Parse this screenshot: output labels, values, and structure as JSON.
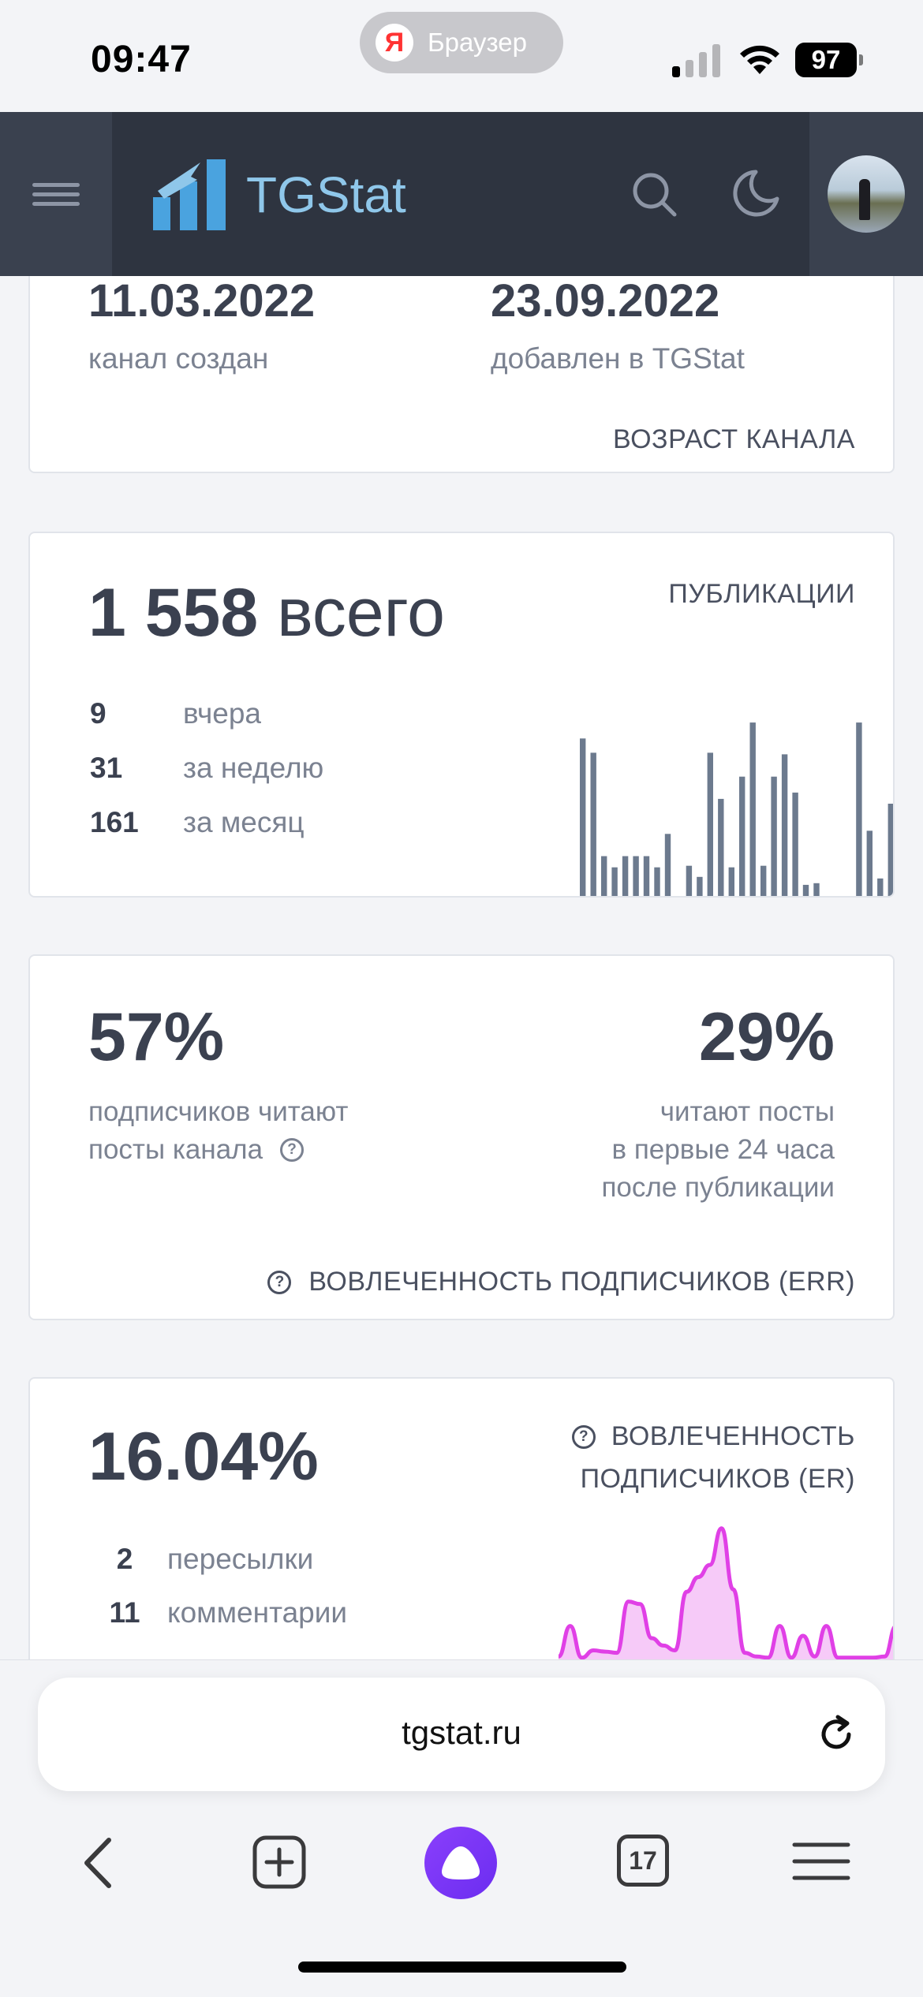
{
  "status_bar": {
    "time": "09:47",
    "browser_label": "Браузер",
    "battery": "97"
  },
  "header": {
    "logo_text": "TGStat"
  },
  "age_card": {
    "created_date": "11.03.2022",
    "created_label": "канал создан",
    "added_date": "23.09.2022",
    "added_label": "добавлен в TGStat",
    "section_title": "ВОЗРАСТ КАНАЛА"
  },
  "publications_card": {
    "total_number": "1 558",
    "total_suffix": "всего",
    "section_title": "ПУБЛИКАЦИИ",
    "rows": [
      {
        "value": "9",
        "label": "вчера"
      },
      {
        "value": "31",
        "label": "за неделю"
      },
      {
        "value": "161",
        "label": "за месяц"
      }
    ]
  },
  "err_card": {
    "left_percent": "57%",
    "left_line1": "подписчиков читают",
    "left_line2": "посты канала",
    "right_percent": "29%",
    "right_line1": "читают посты",
    "right_line2": "в первые 24 часа",
    "right_line3": "после публикации",
    "section_title": "ВОВЛЕЧЕННОСТЬ ПОДПИСЧИКОВ (ERR)"
  },
  "er_card": {
    "percent": "16.04%",
    "section_title_line1": "ВОВЛЕЧЕННОСТЬ",
    "section_title_line2": "ПОДПИСЧИКОВ (ER)",
    "rows": [
      {
        "value": "2",
        "label": "пересылки"
      },
      {
        "value": "11",
        "label": "комментарии"
      }
    ]
  },
  "browser": {
    "url": "tgstat.ru",
    "tab_count": "17"
  },
  "chart_data": [
    {
      "type": "bar",
      "values": [
        100,
        91,
        26,
        19,
        26,
        26,
        26,
        19,
        40,
        1,
        20,
        13,
        91,
        62,
        19,
        76,
        110,
        20,
        76,
        90,
        66,
        8,
        9,
        1,
        1,
        1,
        110,
        42,
        12,
        59
      ],
      "ylim": [
        0,
        115
      ],
      "color": "#6c7a8e"
    },
    {
      "type": "area",
      "values": [
        5,
        30,
        4,
        10,
        9,
        8,
        50,
        48,
        20,
        14,
        10,
        58,
        70,
        80,
        110,
        60,
        8,
        5,
        4,
        30,
        4,
        22,
        5,
        30,
        4,
        4,
        4,
        4,
        5,
        30
      ],
      "ylim": [
        0,
        115
      ],
      "color": "#e040e6"
    }
  ]
}
